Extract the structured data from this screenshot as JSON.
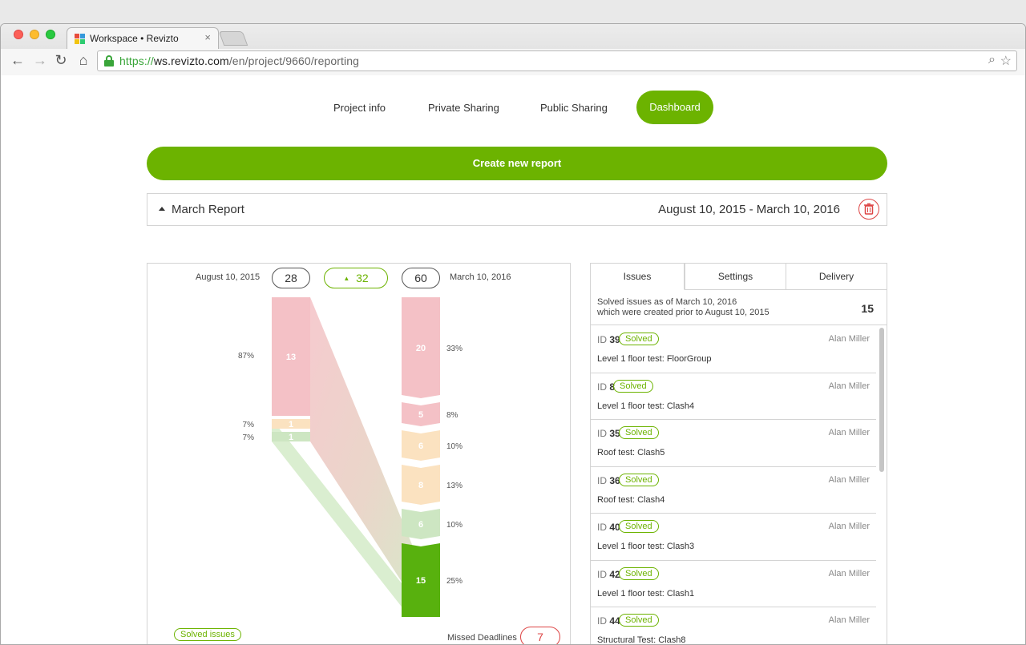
{
  "browser": {
    "tab_title": "Workspace • Revizto",
    "tab_close": "×",
    "url_scheme": "https://",
    "url_host": "ws.revizto.com",
    "url_path": "/en/project/9660/reporting",
    "zoom_icon": "⌕",
    "star_icon": "☆"
  },
  "nav": {
    "items": [
      "Project info",
      "Private Sharing",
      "Public Sharing"
    ],
    "active": "Dashboard"
  },
  "create_button": "Create new report",
  "report": {
    "title": "March Report",
    "range": "August 10, 2015 - March 10, 2016"
  },
  "chart_data": {
    "type": "sankey",
    "left": {
      "date": "August 10, 2015",
      "total": "28",
      "nodes": [
        {
          "value": 13,
          "pct": "87%",
          "color": "#f4c1c6"
        },
        {
          "value": 1,
          "pct": "7%",
          "color": "#fbe2c0"
        },
        {
          "value": 1,
          "pct": "7%",
          "color": "#cde6c2"
        }
      ]
    },
    "delta": "32",
    "right": {
      "date": "March 10, 2016",
      "total": "60",
      "nodes": [
        {
          "value": 20,
          "pct": "33%",
          "color": "#f4c1c6"
        },
        {
          "value": 5,
          "pct": "8%",
          "color": "#f4c1c6"
        },
        {
          "value": 6,
          "pct": "10%",
          "color": "#fbe2c0"
        },
        {
          "value": 8,
          "pct": "13%",
          "color": "#fbe2c0"
        },
        {
          "value": 6,
          "pct": "10%",
          "color": "#cde6c2"
        },
        {
          "value": 15,
          "pct": "25%",
          "color": "#58b10e"
        }
      ]
    },
    "legend_solved": "Solved issues",
    "missed_label": "Missed Deadlines",
    "missed_count": "7"
  },
  "side": {
    "tabs": [
      "Issues",
      "Settings",
      "Delivery"
    ],
    "summary_line1": "Solved issues as of March 10, 2016",
    "summary_line2": "which were created prior to August 10, 2015",
    "summary_count": "15",
    "issues": [
      {
        "id": "39",
        "status": "Solved",
        "author": "Alan Miller",
        "name": "Level 1 floor test: FloorGroup"
      },
      {
        "id": "8",
        "status": "Solved",
        "author": "Alan Miller",
        "name": "Level 1 floor test: Clash4"
      },
      {
        "id": "35",
        "status": "Solved",
        "author": "Alan Miller",
        "name": "Roof test: Clash5"
      },
      {
        "id": "36",
        "status": "Solved",
        "author": "Alan Miller",
        "name": "Roof test: Clash4"
      },
      {
        "id": "40",
        "status": "Solved",
        "author": "Alan Miller",
        "name": "Level 1 floor test: Clash3"
      },
      {
        "id": "42",
        "status": "Solved",
        "author": "Alan Miller",
        "name": "Level 1 floor test: Clash1"
      },
      {
        "id": "44",
        "status": "Solved",
        "author": "Alan Miller",
        "name": "Structural Test: Clash8"
      }
    ]
  }
}
